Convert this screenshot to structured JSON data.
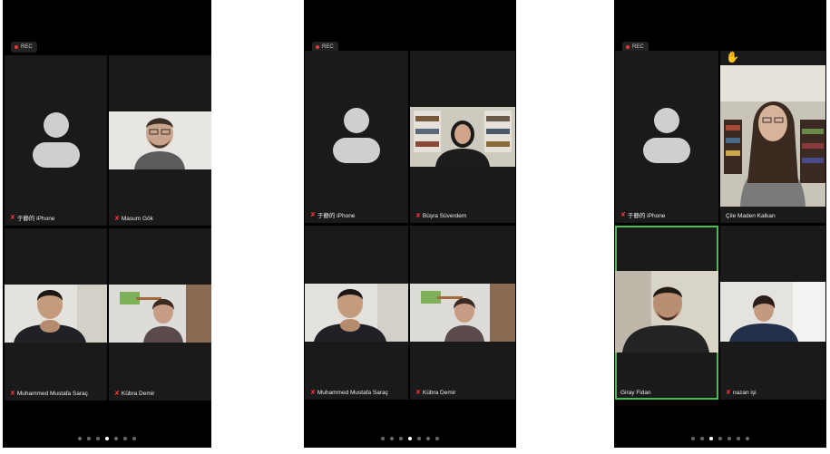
{
  "rec_label": "REC",
  "screens": [
    {
      "tiles": [
        {
          "name": "于静的 iPhone",
          "muted": true
        },
        {
          "name": "Masum Gök",
          "muted": true
        },
        {
          "name": "Muhammed Mustafa Saraç",
          "muted": true
        },
        {
          "name": "Kübra Demir",
          "muted": true
        }
      ],
      "page_indicator": {
        "total": 7,
        "current": 4
      }
    },
    {
      "tiles": [
        {
          "name": "于静的 iPhone",
          "muted": true
        },
        {
          "name": "Büşra Süverdem",
          "muted": true
        },
        {
          "name": "Muhammed Mustafa Saraç",
          "muted": true
        },
        {
          "name": "Kübra Demir",
          "muted": true
        }
      ],
      "page_indicator": {
        "total": 7,
        "current": 4
      }
    },
    {
      "raised_hand_icon": "raised-hand-icon",
      "tiles": [
        {
          "name": "于静的 iPhone",
          "muted": true
        },
        {
          "name": "Çile Maden Kalkan",
          "muted": false
        },
        {
          "name": "Giray Fidan",
          "muted": false,
          "active_speaker": true
        },
        {
          "name": "nazan işi",
          "muted": true
        }
      ],
      "page_indicator": {
        "total": 7,
        "current": 3
      }
    }
  ],
  "colors": {
    "active_speaker_border": "#3fc14a",
    "muted_mic": "#e33333",
    "tile_bg": "#1a1a1a"
  }
}
